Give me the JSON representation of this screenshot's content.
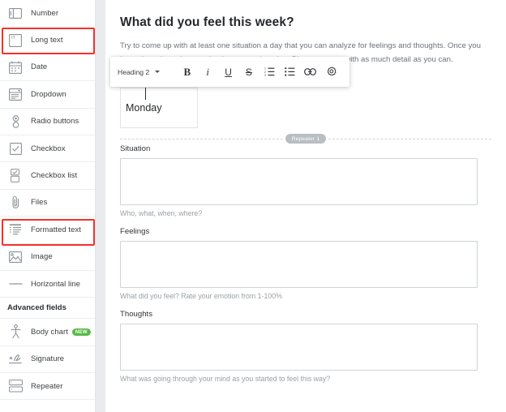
{
  "sidebar": {
    "basic_fields": [
      {
        "label": "Number",
        "icon": "number-field-icon"
      },
      {
        "label": "Long text",
        "icon": "long-text-field-icon"
      },
      {
        "label": "Date",
        "icon": "date-field-icon"
      },
      {
        "label": "Dropdown",
        "icon": "dropdown-field-icon"
      },
      {
        "label": "Radio buttons",
        "icon": "radio-buttons-field-icon"
      },
      {
        "label": "Checkbox",
        "icon": "checkbox-field-icon"
      },
      {
        "label": "Checkbox list",
        "icon": "checkbox-list-field-icon"
      },
      {
        "label": "Files",
        "icon": "paperclip-icon"
      },
      {
        "label": "Formatted text",
        "icon": "formatted-text-field-icon"
      },
      {
        "label": "Image",
        "icon": "image-field-icon"
      },
      {
        "label": "Horizontal line",
        "icon": "horizontal-line-field-icon"
      }
    ],
    "advanced_header": "Advanced fields",
    "advanced_fields": [
      {
        "label": "Body chart",
        "icon": "body-chart-icon",
        "badge": "NEW"
      },
      {
        "label": "Signature",
        "icon": "signature-icon",
        "badge": ""
      },
      {
        "label": "Repeater",
        "icon": "repeater-icon",
        "badge": ""
      }
    ],
    "highlight_color": "#f4322c",
    "highlighted": [
      "Long text",
      "Formatted text"
    ]
  },
  "main": {
    "title": "What did you feel this week?",
    "intro": "Try to come up with at least one situation a day that you can analyze for feelings and thoughts. Once you have done that, please write down your thoughts. Please answer with as much detail as you can.",
    "heading_value": "Monday",
    "repeater_label": "Repeater 1",
    "fields": [
      {
        "label": "Situation",
        "value": "",
        "help": "Who, what, when, where?"
      },
      {
        "label": "Feelings",
        "value": "",
        "help": "What did you feel? Rate your emotion from 1-100%"
      },
      {
        "label": "Thoughts",
        "value": "",
        "help": "What was going through your mind as you started to feel this way?"
      }
    ]
  },
  "toolbar": {
    "style_value": "Heading 2",
    "buttons": [
      {
        "label": "B",
        "name": "bold-button"
      },
      {
        "label": "i",
        "name": "italic-button"
      },
      {
        "label": "U",
        "name": "underline-button"
      },
      {
        "label": "S",
        "name": "strikethrough-button"
      },
      {
        "label": "",
        "name": "ordered-list-button"
      },
      {
        "label": "",
        "name": "bullet-list-button"
      },
      {
        "label": "",
        "name": "link-button"
      },
      {
        "label": "",
        "name": "settings-gear-button"
      }
    ]
  }
}
